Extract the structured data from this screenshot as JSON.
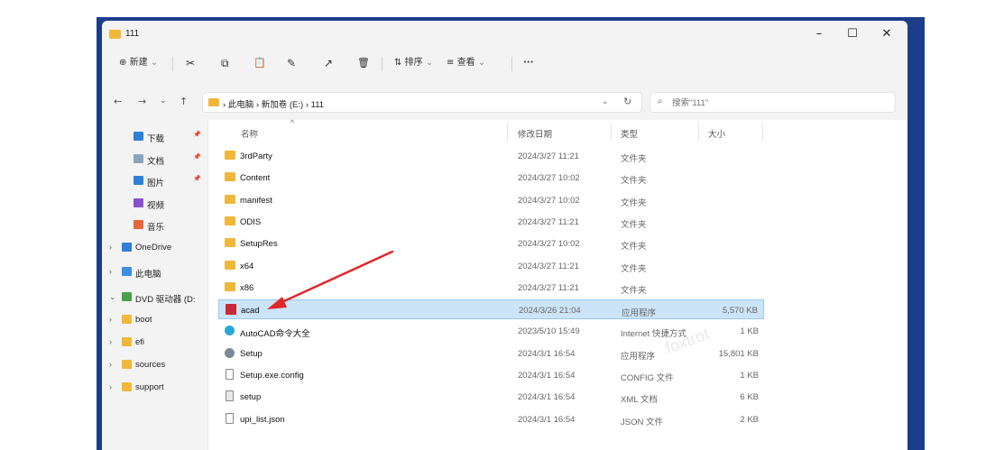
{
  "window": {
    "title": "111",
    "minimize": "–",
    "maximize": "☐",
    "close": "✕"
  },
  "toolbar": {
    "new_label": "新建",
    "new_icon": "⊕",
    "new_chevron": "⌄",
    "cut_icon": "✂",
    "copy_icon": "⧉",
    "paste_icon": "📋",
    "rename_icon": "✎",
    "share_icon": "↗",
    "delete_icon": "🗑",
    "sort_label": "排序",
    "sort_icon": "⇅",
    "view_label": "查看",
    "view_icon": "≡",
    "more_label": "···"
  },
  "nav": {
    "back": "←",
    "forward": "→",
    "recent": "⌄",
    "up": "↑",
    "breadcrumb": "› 此电脑 › 新加卷 (E:) › 111",
    "dropdown": "⌄",
    "refresh": "↻"
  },
  "search": {
    "icon": "⌕",
    "placeholder": "搜索\"111\""
  },
  "sidebar": {
    "items": [
      {
        "label": "下载",
        "icon": "download-icon",
        "color": "#2f7fd8",
        "pinned": true
      },
      {
        "label": "文档",
        "icon": "documents-icon",
        "color": "#8aa4c0",
        "pinned": true
      },
      {
        "label": "图片",
        "icon": "pictures-icon",
        "color": "#2f7fd8",
        "pinned": true
      },
      {
        "label": "视频",
        "icon": "videos-icon",
        "color": "#8a4fd0",
        "pinned": false
      },
      {
        "label": "音乐",
        "icon": "music-icon",
        "color": "#e8643a",
        "pinned": false
      },
      {
        "label": "OneDrive",
        "icon": "cloud-icon",
        "color": "#2f7fd8",
        "expand": "›"
      },
      {
        "label": "此电脑",
        "icon": "computer-icon",
        "color": "#3a8ee6",
        "expand": "›"
      },
      {
        "label": "DVD 驱动器 (D:",
        "icon": "dvd-icon",
        "color": "#4aa04a",
        "expand": "⌄"
      },
      {
        "label": "boot",
        "icon": "folder-icon",
        "color": "#f0b83a",
        "expand": "›"
      },
      {
        "label": "efi",
        "icon": "folder-icon",
        "color": "#f0b83a",
        "expand": "›"
      },
      {
        "label": "sources",
        "icon": "folder-icon",
        "color": "#f0b83a",
        "expand": "›"
      },
      {
        "label": "support",
        "icon": "folder-icon",
        "color": "#f0b83a",
        "expand": "›"
      }
    ],
    "pin_glyph": "📌"
  },
  "columns": {
    "name": "名称",
    "date": "修改日期",
    "type": "类型",
    "size": "大小",
    "sort_arrow": "^"
  },
  "files": [
    {
      "name": "3rdParty",
      "date": "2024/3/27 11:21",
      "type": "文件夹",
      "size": "",
      "icon": "folder-icon",
      "color": "#f0b83a"
    },
    {
      "name": "Content",
      "date": "2024/3/27 10:02",
      "type": "文件夹",
      "size": "",
      "icon": "folder-icon",
      "color": "#f0b83a"
    },
    {
      "name": "manifest",
      "date": "2024/3/27 10:02",
      "type": "文件夹",
      "size": "",
      "icon": "folder-icon",
      "color": "#f0b83a"
    },
    {
      "name": "ODIS",
      "date": "2024/3/27 11:21",
      "type": "文件夹",
      "size": "",
      "icon": "folder-icon",
      "color": "#f0b83a"
    },
    {
      "name": "SetupRes",
      "date": "2024/3/27 10:02",
      "type": "文件夹",
      "size": "",
      "icon": "folder-icon",
      "color": "#f0b83a"
    },
    {
      "name": "x64",
      "date": "2024/3/27 11:21",
      "type": "文件夹",
      "size": "",
      "icon": "folder-icon",
      "color": "#f0b83a"
    },
    {
      "name": "x86",
      "date": "2024/3/27 11:21",
      "type": "文件夹",
      "size": "",
      "icon": "folder-icon",
      "color": "#f0b83a"
    },
    {
      "name": "acad",
      "date": "2024/3/26 21:04",
      "type": "应用程序",
      "size": "5,570 KB",
      "icon": "autocad-app-icon",
      "color": "#c8283a",
      "selected": true
    },
    {
      "name": "AutoCAD命令大全",
      "date": "2023/5/10 15:49",
      "type": "Internet 快捷方式",
      "size": "1 KB",
      "icon": "internet-shortcut-icon",
      "color": "#2aa6d8"
    },
    {
      "name": "Setup",
      "date": "2024/3/1 16:54",
      "type": "应用程序",
      "size": "15,801 KB",
      "icon": "setup-app-icon",
      "color": "#7a8a9a"
    },
    {
      "name": "Setup.exe.config",
      "date": "2024/3/1 16:54",
      "type": "CONFIG 文件",
      "size": "1 KB",
      "icon": "file-icon",
      "color": "#ffffff"
    },
    {
      "name": "setup",
      "date": "2024/3/1 16:54",
      "type": "XML 文档",
      "size": "6 KB",
      "icon": "xml-file-icon",
      "color": "#e8e8e8"
    },
    {
      "name": "upi_list.json",
      "date": "2024/3/1 16:54",
      "type": "JSON 文件",
      "size": "2 KB",
      "icon": "file-icon",
      "color": "#ffffff"
    }
  ],
  "watermark": "foxtrot",
  "colors": {
    "accent": "#2f7fd8",
    "selection": "#cce4f7",
    "annotation_arrow": "#e0282a",
    "desktop": "#1d3d8a"
  }
}
